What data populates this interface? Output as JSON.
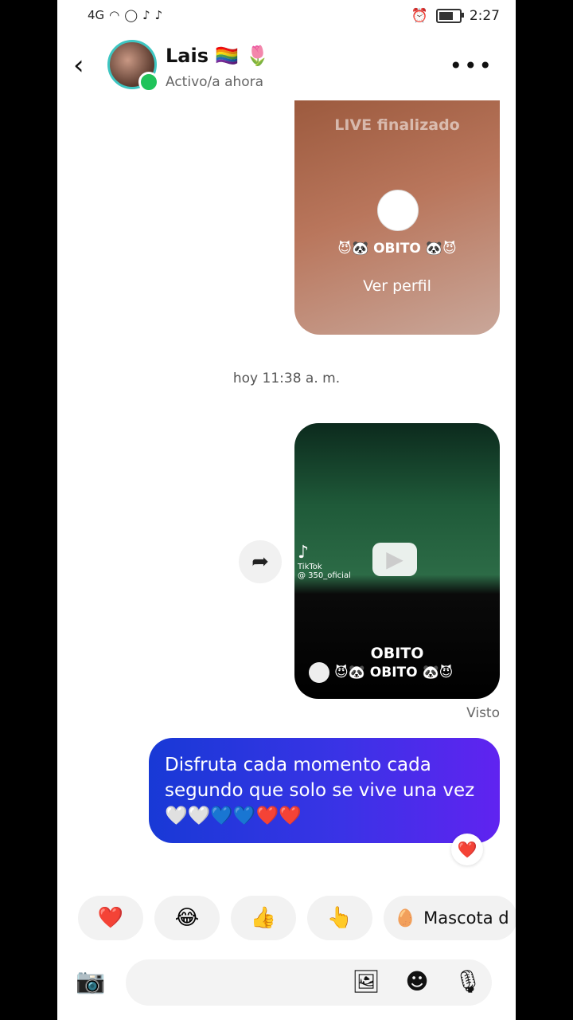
{
  "status_bar": {
    "left_icons": [
      "network-icon",
      "wifi-icon",
      "whatsapp-icon",
      "tiktok-icon",
      "tiktok-lite-icon"
    ],
    "network": "4G",
    "time": "2:27"
  },
  "header": {
    "name": "Lais 🏳️‍🌈 🌷",
    "status": "Activo/a ahora",
    "more": "•••"
  },
  "live_card": {
    "title": "LIVE finalizado",
    "name": "😈🐼 OBITO 🐼😈",
    "link": "Ver perfil"
  },
  "timestamp": "hoy 11:38 a. m.",
  "video_card": {
    "tiktok_label": "TikTok",
    "tiktok_handle": "@ 350_oficial",
    "caption": "OBITO",
    "author": "😈🐼 OBITO 🐼😈"
  },
  "seen_label": "Visto",
  "message": {
    "text": "Disfruta cada momento cada segundo que solo se vive una vez 🤍🤍💙💙❤️❤️",
    "reaction": "❤️"
  },
  "quick_replies": [
    "❤️",
    "😂",
    "👍",
    "👆",
    "Mascota d"
  ],
  "quick_reply_last_emoji": "🥚",
  "composer": {
    "camera": "📷",
    "gallery": "🖼",
    "sticker": "☻",
    "mic": "🎙"
  }
}
